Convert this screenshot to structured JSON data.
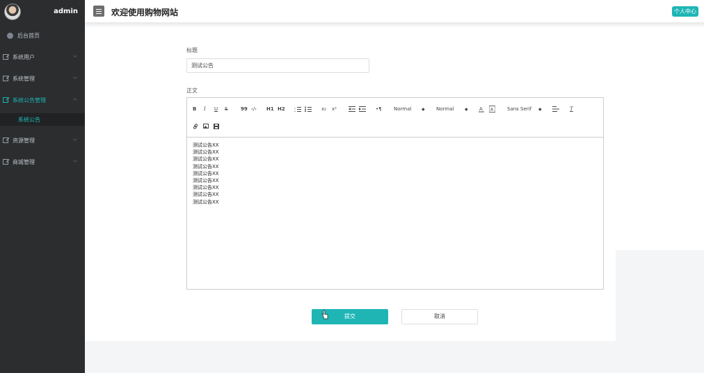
{
  "sidebar": {
    "user": "admin",
    "items": [
      {
        "label": "后台首页"
      },
      {
        "label": "系统用户"
      },
      {
        "label": "系统管理"
      },
      {
        "label": "系统公告管理"
      },
      {
        "label": "资源管理"
      },
      {
        "label": "商城管理"
      }
    ],
    "submenu": {
      "label": "系统公告"
    }
  },
  "header": {
    "title": "欢迎使用购物网站",
    "personal_center": "个人中心"
  },
  "form": {
    "title_label": "标题",
    "title_value": "测试公告",
    "body_label": "正文",
    "body_lines": [
      "测试公告XX",
      "测试公告XX",
      "测试公告XX",
      "测试公告XX",
      "测试公告XX",
      "测试公告XX",
      "测试公告XX",
      "测试公告XX",
      "测试公告XX"
    ],
    "submit": "提交",
    "cancel": "取消"
  },
  "toolbar": {
    "bold": "B",
    "italic": "I",
    "underline": "U",
    "strike": "S",
    "quote": "99",
    "code": "‹/›",
    "h1": "H1",
    "h2": "H2",
    "sub": "x₂",
    "sup": "x²",
    "size_select": "Normal",
    "header_select": "Normal",
    "font_select": "Sans Serif"
  },
  "colors": {
    "accent": "#1fb5b5",
    "sidebar": "#2b2d2f"
  }
}
